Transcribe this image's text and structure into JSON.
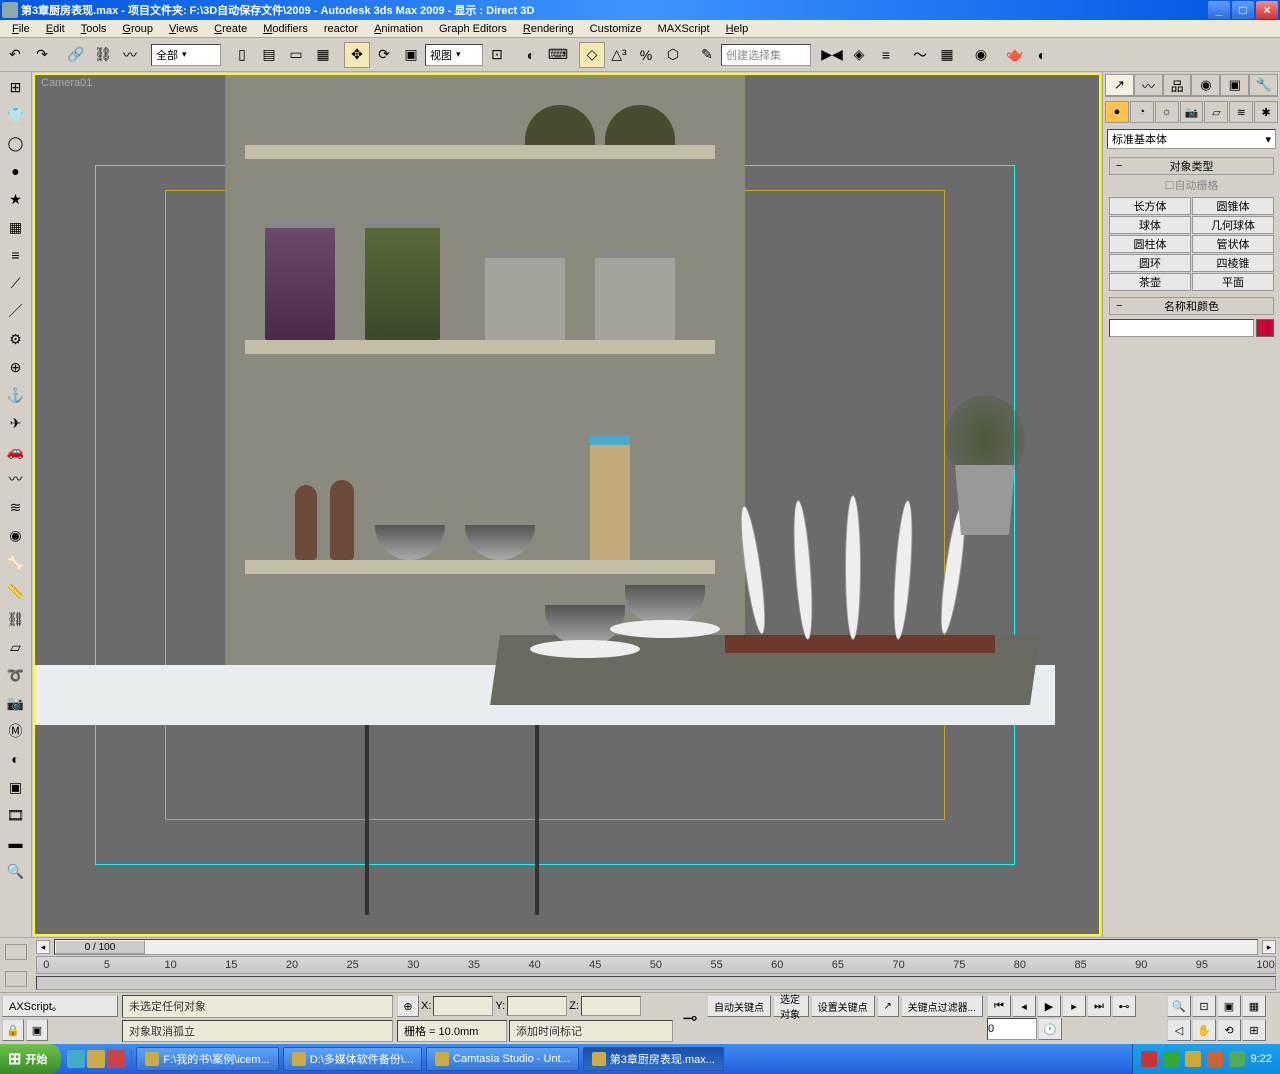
{
  "title": "第3章厨房表现.max   - 项目文件夹:  F:\\3D自动保存文件\\2009      - Autodesk 3ds Max  2009      - 显示 : Direct 3D",
  "menus": [
    "File",
    "Edit",
    "Tools",
    "Group",
    "Views",
    "Create",
    "Modifiers",
    "reactor",
    "Animation",
    "Graph Editors",
    "Rendering",
    "Customize",
    "MAXScript",
    "Help"
  ],
  "menu_keys": [
    "F",
    "E",
    "T",
    "G",
    "V",
    "C",
    "M",
    "",
    "A",
    "",
    "R",
    "",
    "",
    "H"
  ],
  "toolbar": {
    "filter_label": "全部",
    "ref_label": "视图",
    "named_sel": "创建选择集"
  },
  "viewport": {
    "label": "Camera01"
  },
  "command_panel": {
    "dropdown": "标准基本体",
    "rollup_object_type": "对象类型",
    "autogrid": "自动栅格",
    "primitives": [
      [
        "长方体",
        "圆锥体"
      ],
      [
        "球体",
        "几何球体"
      ],
      [
        "圆柱体",
        "管状体"
      ],
      [
        "圆环",
        "四棱锥"
      ],
      [
        "茶壶",
        "平面"
      ]
    ],
    "rollup_name_color": "名称和颜色"
  },
  "timeline": {
    "handle": "0 / 100",
    "ticks": [
      "0",
      "5",
      "10",
      "15",
      "20",
      "25",
      "30",
      "35",
      "40",
      "45",
      "50",
      "55",
      "60",
      "65",
      "70",
      "75",
      "80",
      "85",
      "90",
      "95",
      "100"
    ]
  },
  "status": {
    "maxscript_btn": "AXScript。",
    "line1": "未选定任何对象",
    "line2": "对象取消孤立",
    "x_label": "X:",
    "y_label": "Y:",
    "z_label": "Z:",
    "grid": "栅格 = 10.0mm",
    "auto_key": "自动关键点",
    "sel_obj": "选定对象",
    "set_key": "设置关键点",
    "key_filter": "关键点过滤器...",
    "add_time_tag": "添加时间标记",
    "frame": "0"
  },
  "taskbar": {
    "start": "开始",
    "tasks": [
      "F:\\我的书\\案例\\icem...",
      "D:\\多媒体软件备份\\...",
      "Camtasia Studio - Unt...",
      "第3章厨房表现.max..."
    ],
    "time": "9:22"
  }
}
